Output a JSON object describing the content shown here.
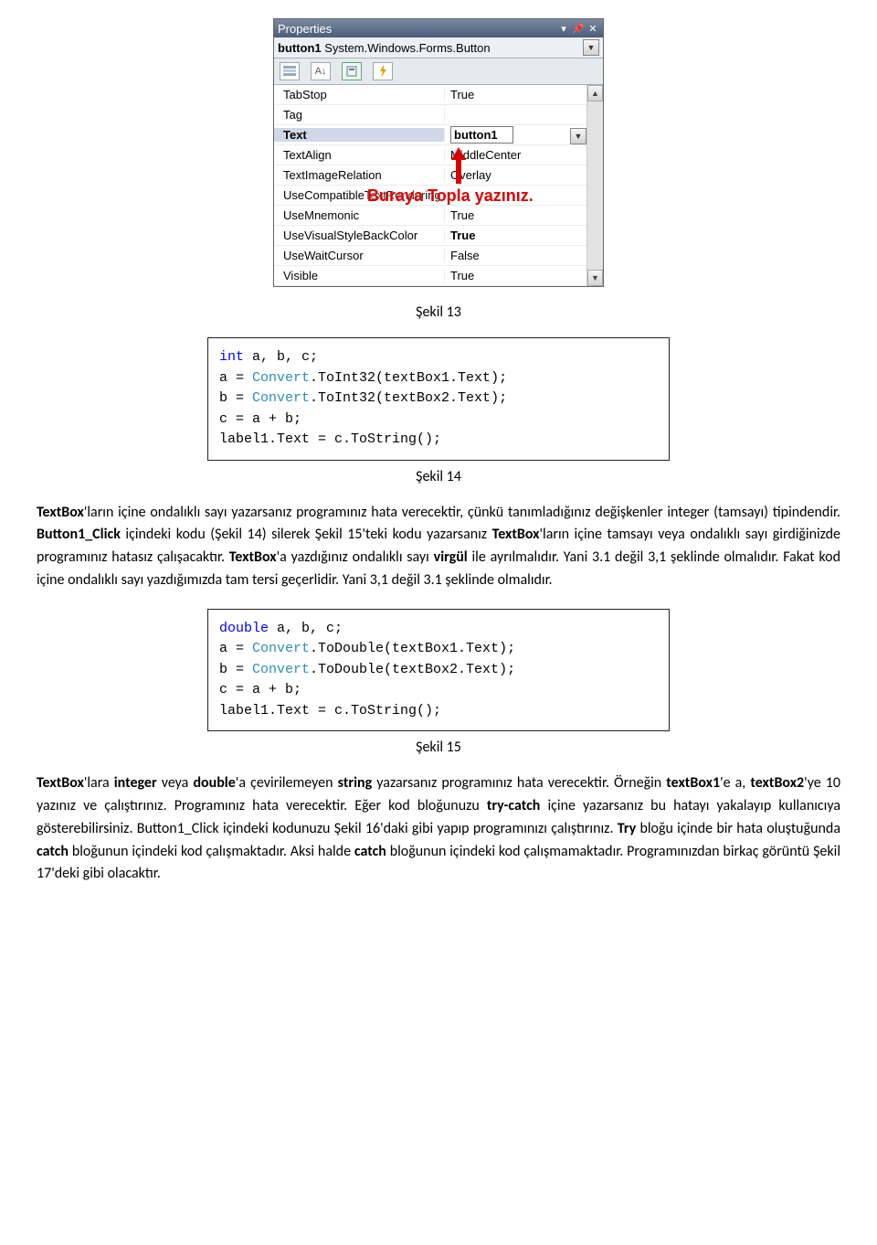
{
  "propertiesPanel": {
    "title": "Properties",
    "object": {
      "name": "button1",
      "type": "System.Windows.Forms.Button"
    },
    "rows": [
      {
        "name": "TabStop",
        "value": "True"
      },
      {
        "name": "Tag",
        "value": ""
      },
      {
        "name": "Text",
        "value": "button1",
        "selected": true
      },
      {
        "name": "TextAlign",
        "value": "MiddleCenter"
      },
      {
        "name": "TextImageRelation",
        "value": "Overlay"
      },
      {
        "name": "UseCompatibleTextRendering",
        "value": ""
      },
      {
        "name": "UseMnemonic",
        "value": "True"
      },
      {
        "name": "UseVisualStyleBackColor",
        "value": "True",
        "boldValue": true
      },
      {
        "name": "UseWaitCursor",
        "value": "False"
      },
      {
        "name": "Visible",
        "value": "True"
      }
    ],
    "annotation": "Buraya Topla yazınız."
  },
  "captions": {
    "fig13": "Şekil 13",
    "fig14": "Şekil 14",
    "fig15": "Şekil 15"
  },
  "code1": {
    "l1a": "int",
    "l1b": " a, b, c;",
    "l2a": "a = ",
    "l2b": "Convert",
    "l2c": ".ToInt32(textBox1.Text);",
    "l3a": "b = ",
    "l3b": "Convert",
    "l3c": ".ToInt32(textBox2.Text);",
    "l4": "c = a + b;",
    "l5": "label1.Text = c.ToString();"
  },
  "code2": {
    "l1a": "double",
    "l1b": " a, b, c;",
    "l2a": "a = ",
    "l2b": "Convert",
    "l2c": ".ToDouble(textBox1.Text);",
    "l3a": "b = ",
    "l3b": "Convert",
    "l3c": ".ToDouble(textBox2.Text);",
    "l4": "c = a + b;",
    "l5": "label1.Text = c.ToString();"
  },
  "para1": {
    "p1": "TextBox",
    "p2": "'ların içine ondalıklı sayı yazarsanız programınız hata verecektir, çünkü tanımladığınız değişkenler integer (tamsayı) tipindendir. ",
    "p3": "Button1_Click",
    "p4": " içindeki kodu (Şekil 14) silerek Şekil 15'teki kodu yazarsanız ",
    "p5": "TextBox",
    "p6": "'ların içine tamsayı veya ondalıklı sayı girdiğinizde programınız hatasız çalışacaktır. ",
    "p7": "TextBox",
    "p8": "'a yazdığınız ondalıklı sayı ",
    "p9": "virgül",
    "p10": " ile ayrılmalıdır. Yani 3.1 değil 3,1 şeklinde olmalıdır. Fakat kod içine ondalıklı sayı yazdığımızda tam tersi geçerlidir. Yani 3,1 değil 3.1 şeklinde olmalıdır."
  },
  "para2": {
    "p1": "TextBox",
    "p2": "'lara ",
    "p3": "integer",
    "p4": " veya ",
    "p5": "double",
    "p6": "'a çevirilemeyen ",
    "p7": "string",
    "p8": " yazarsanız programınız hata verecektir. Örneğin ",
    "p9": "textBox1",
    "p10": "'e a, ",
    "p11": "textBox2",
    "p12": "'ye 10 yazınız ve çalıştırınız. Programınız hata verecektir. Eğer kod bloğunuzu ",
    "p13": "try-catch",
    "p14": " içine yazarsanız bu hatayı yakalayıp kullanıcıya gösterebilirsiniz. Button1_Click içindeki kodunuzu Şekil 16'daki gibi yapıp programınızı çalıştırınız. ",
    "p15": "Try",
    "p16": " bloğu içinde bir hata oluştuğunda ",
    "p17": "catch",
    "p18": " bloğunun içindeki kod çalışmaktadır. Aksi halde ",
    "p19": "catch",
    "p20": " bloğunun içindeki kod çalışmamaktadır. Programınızdan birkaç görüntü Şekil 17'deki gibi olacaktır."
  }
}
